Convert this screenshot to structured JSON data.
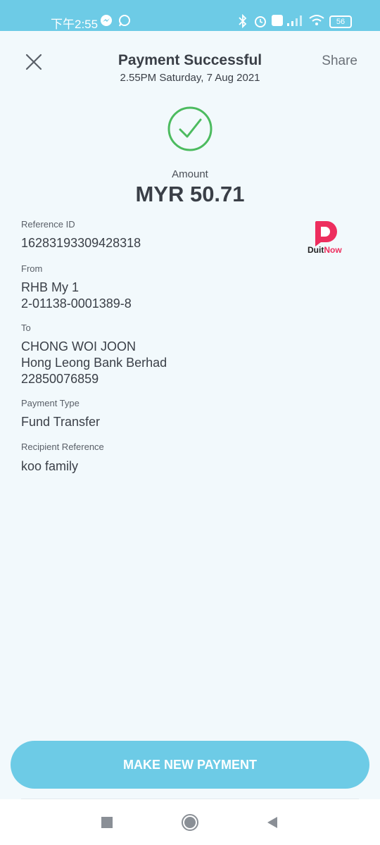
{
  "status_bar": {
    "time": "下午2:55",
    "battery": "56"
  },
  "header": {
    "title": "Payment Successful",
    "datetime": "2.55PM Saturday, 7 Aug 2021",
    "share_label": "Share"
  },
  "amount": {
    "label": "Amount",
    "value": "MYR 50.71"
  },
  "details": {
    "reference_id_label": "Reference ID",
    "reference_id": "16283193309428318",
    "from_label": "From",
    "from_name": "RHB My 1",
    "from_account": "2-01138-0001389-8",
    "to_label": "To",
    "to_name": "CHONG WOI JOON",
    "to_bank": "Hong Leong Bank Berhad",
    "to_account": "22850076859",
    "payment_type_label": "Payment Type",
    "payment_type": "Fund Transfer",
    "recipient_ref_label": "Recipient Reference",
    "recipient_ref": "koo family"
  },
  "logo": {
    "name": "DuitNow",
    "part1": "Duit",
    "part2": "Now",
    "color": "#ed2e5e"
  },
  "actions": {
    "make_new_payment": "MAKE NEW PAYMENT"
  },
  "colors": {
    "accent": "#6dcbe6",
    "success": "#4cbb5f",
    "background": "#f2f9fc"
  }
}
